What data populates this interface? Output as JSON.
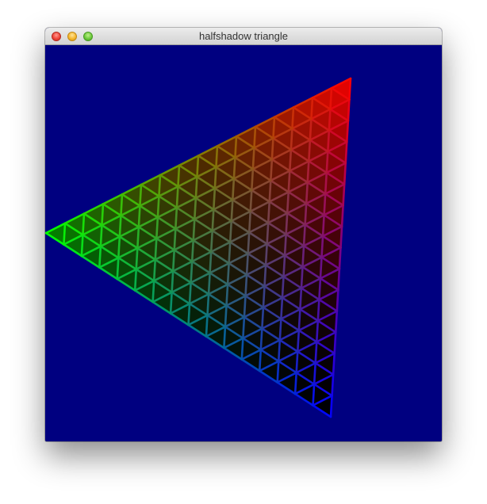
{
  "window": {
    "title": "halfshadow triangle",
    "background_color": "#000080"
  },
  "titlebar": {
    "buttons": [
      {
        "name": "close-button",
        "color": "#f0453a"
      },
      {
        "name": "minimize-button",
        "color": "#f5b72e"
      },
      {
        "name": "zoom-button",
        "color": "#6dca3c"
      }
    ]
  },
  "triangle": {
    "vertex_colors": {
      "top_right": "#ff0000",
      "left": "#00ff00",
      "bottom": "#0000ff"
    },
    "mesh_subdivisions": 16
  }
}
